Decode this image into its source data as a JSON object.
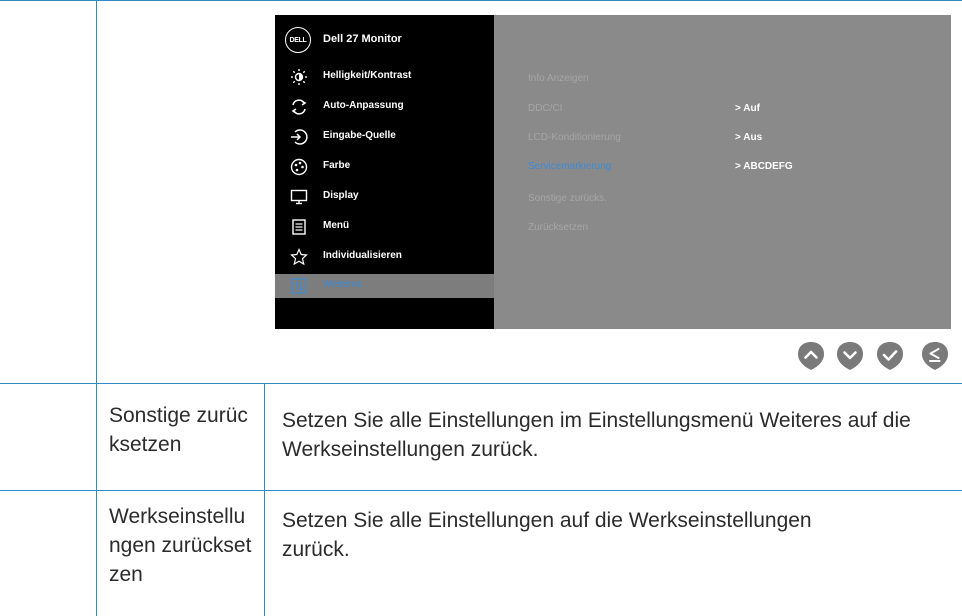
{
  "osd": {
    "logo": "DELL",
    "title": "Dell 27 Monitor",
    "menu": [
      {
        "label": "Helligkeit/Kontrast",
        "icon": "brightness-icon"
      },
      {
        "label": "Auto-Anpassung",
        "icon": "auto-adjust-icon"
      },
      {
        "label": "Eingabe-Quelle",
        "icon": "input-source-icon"
      },
      {
        "label": "Farbe",
        "icon": "color-palette-icon"
      },
      {
        "label": "Display",
        "icon": "display-icon"
      },
      {
        "label": "Menü",
        "icon": "menu-icon"
      },
      {
        "label": "Individualisieren",
        "icon": "star-icon"
      },
      {
        "label": "Weiteres",
        "icon": "others-icon"
      }
    ],
    "submenu": [
      {
        "label": "Info Anzeigen",
        "value": ""
      },
      {
        "label": "DDC/CI",
        "value": "> Auf"
      },
      {
        "label": "LCD-Konditionierung",
        "value": "> Aus"
      },
      {
        "label": "Servicemarkierung",
        "value": "> ABCDEFG"
      },
      {
        "label": "Sonstige zurücks.",
        "value": ""
      },
      {
        "label": "Zurücksetzen",
        "value": ""
      }
    ],
    "nav_buttons": [
      "up-arrow-icon",
      "down-arrow-icon",
      "check-icon",
      "back-icon"
    ],
    "colors": {
      "highlight": "#3b8bd6",
      "nav_button": "#7a7a7a"
    }
  },
  "table": {
    "rows": [
      {
        "name": "Sonstige zurücksetzen",
        "description": "Setzen Sie alle Einstellungen im Einstellungsmenü Weiteres auf die Werkseinstellungen zurück."
      },
      {
        "name": "Werkseinstellungen zurücksetzen",
        "description": "Setzen Sie alle Einstellungen auf die Werkseinstellungen zurück."
      }
    ]
  }
}
